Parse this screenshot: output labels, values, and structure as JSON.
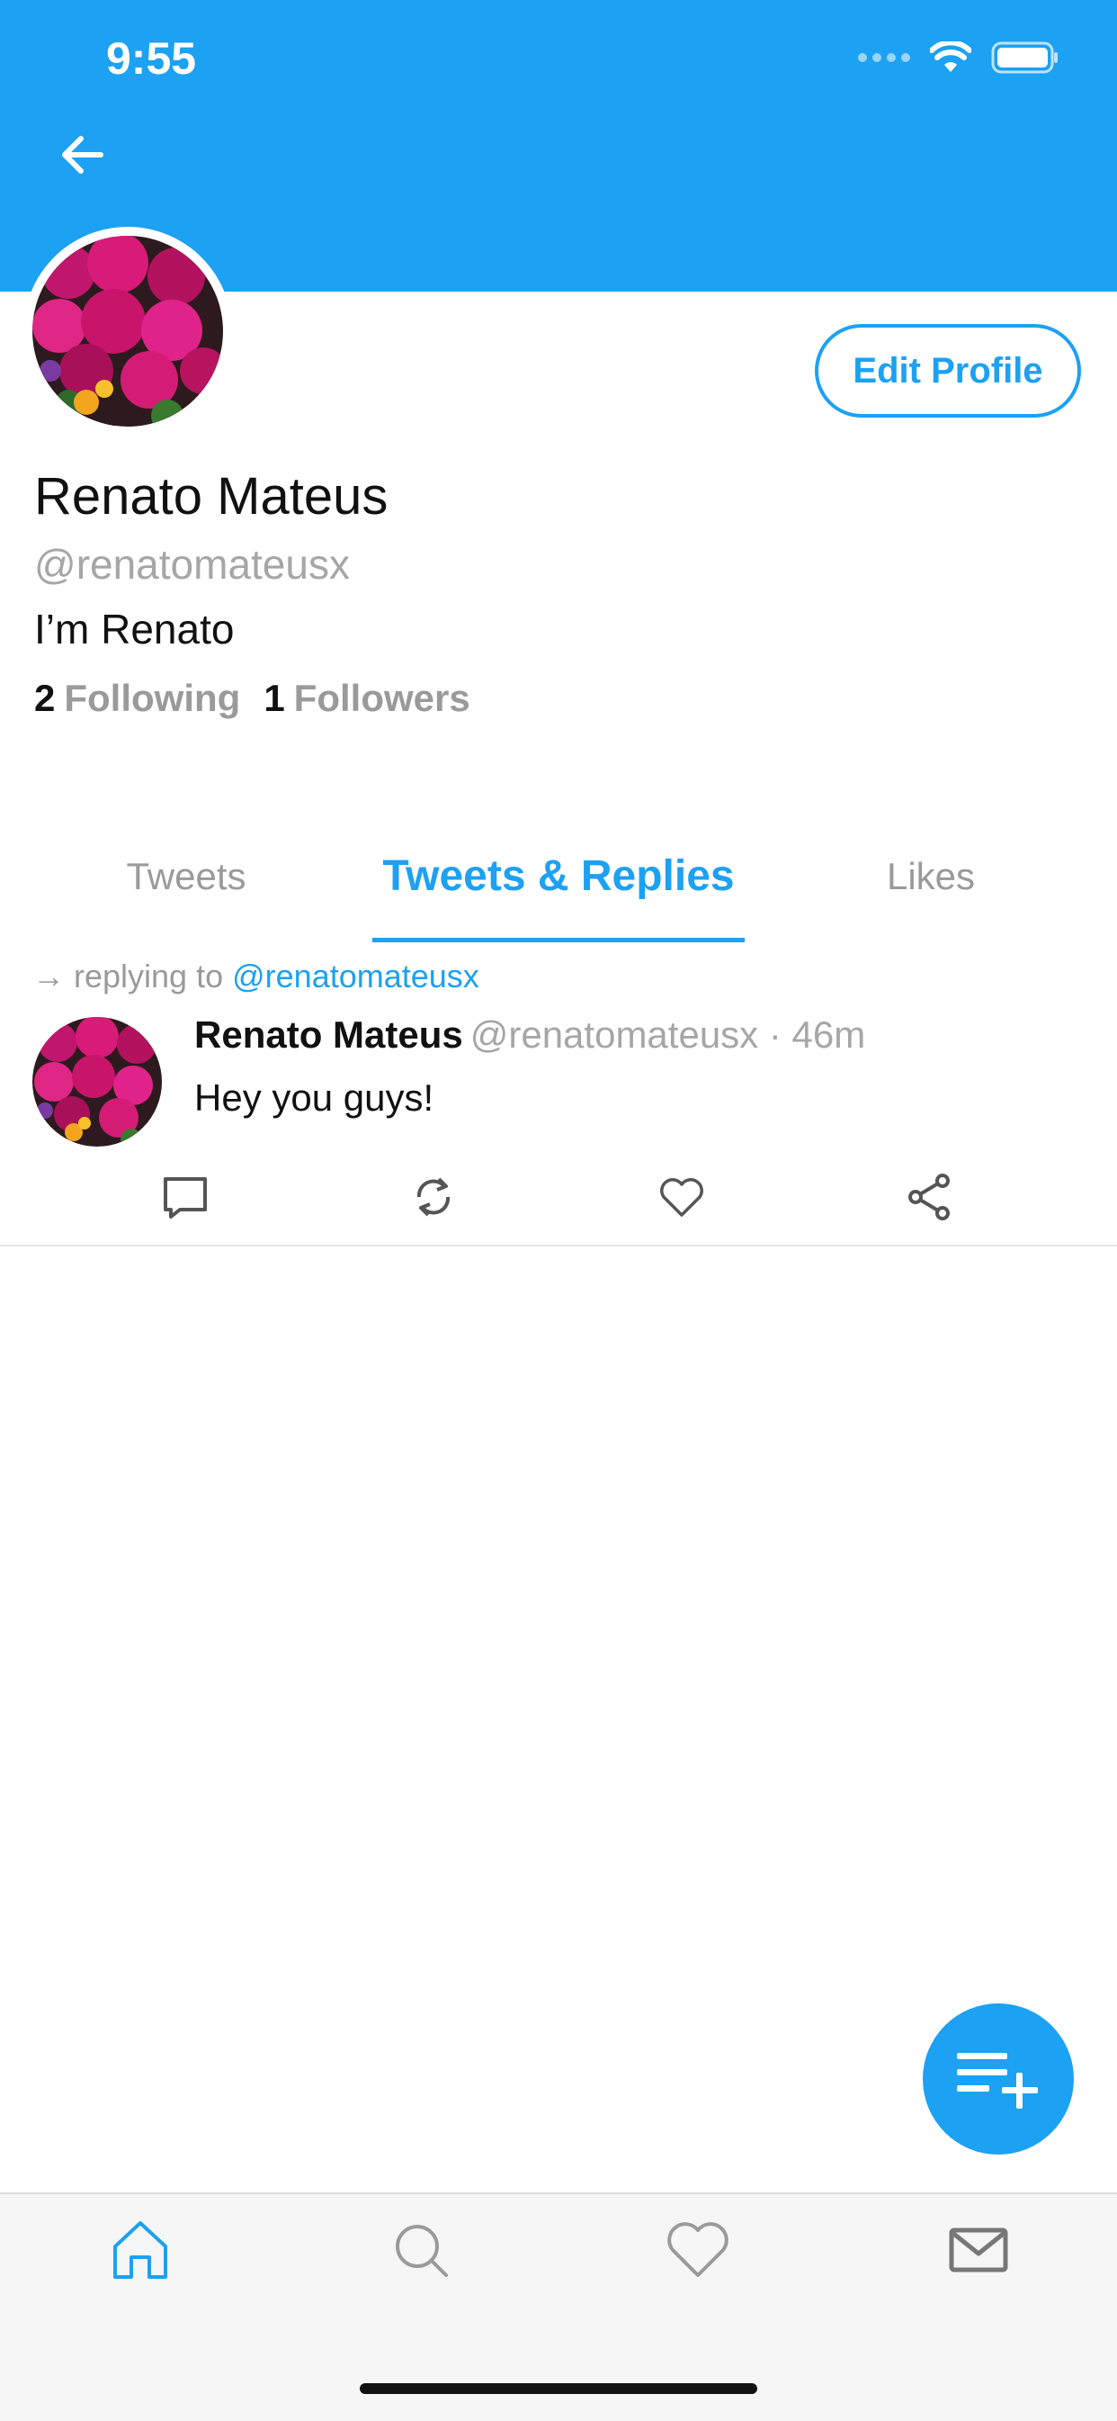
{
  "status_bar": {
    "time": "9:55"
  },
  "profile": {
    "name": "Renato Mateus",
    "handle": "@renatomateusx",
    "bio": "I’m Renato",
    "following_count": "2",
    "following_label": "Following",
    "followers_count": "1",
    "followers_label": "Followers",
    "edit_button_label": "Edit Profile"
  },
  "tabs": [
    {
      "label": "Tweets",
      "active": false
    },
    {
      "label": "Tweets & Replies",
      "active": true
    },
    {
      "label": "Likes",
      "active": false
    }
  ],
  "tweet": {
    "replying_prefix": "→ replying to",
    "replying_to": "@renatomateusx",
    "author": "Renato Mateus",
    "meta": "@renatomateusx · 46m",
    "text": "Hey you guys!"
  },
  "colors": {
    "accent": "#1da1f2",
    "muted_text": "#9a9a9a"
  },
  "icons": {
    "back": "arrow-left-icon",
    "actions": [
      "comment-icon",
      "retweet-icon",
      "heart-icon",
      "share-icon"
    ],
    "fab": "compose-list-plus-icon",
    "nav": [
      "home-icon",
      "search-icon",
      "heart-icon",
      "mail-icon"
    ]
  }
}
